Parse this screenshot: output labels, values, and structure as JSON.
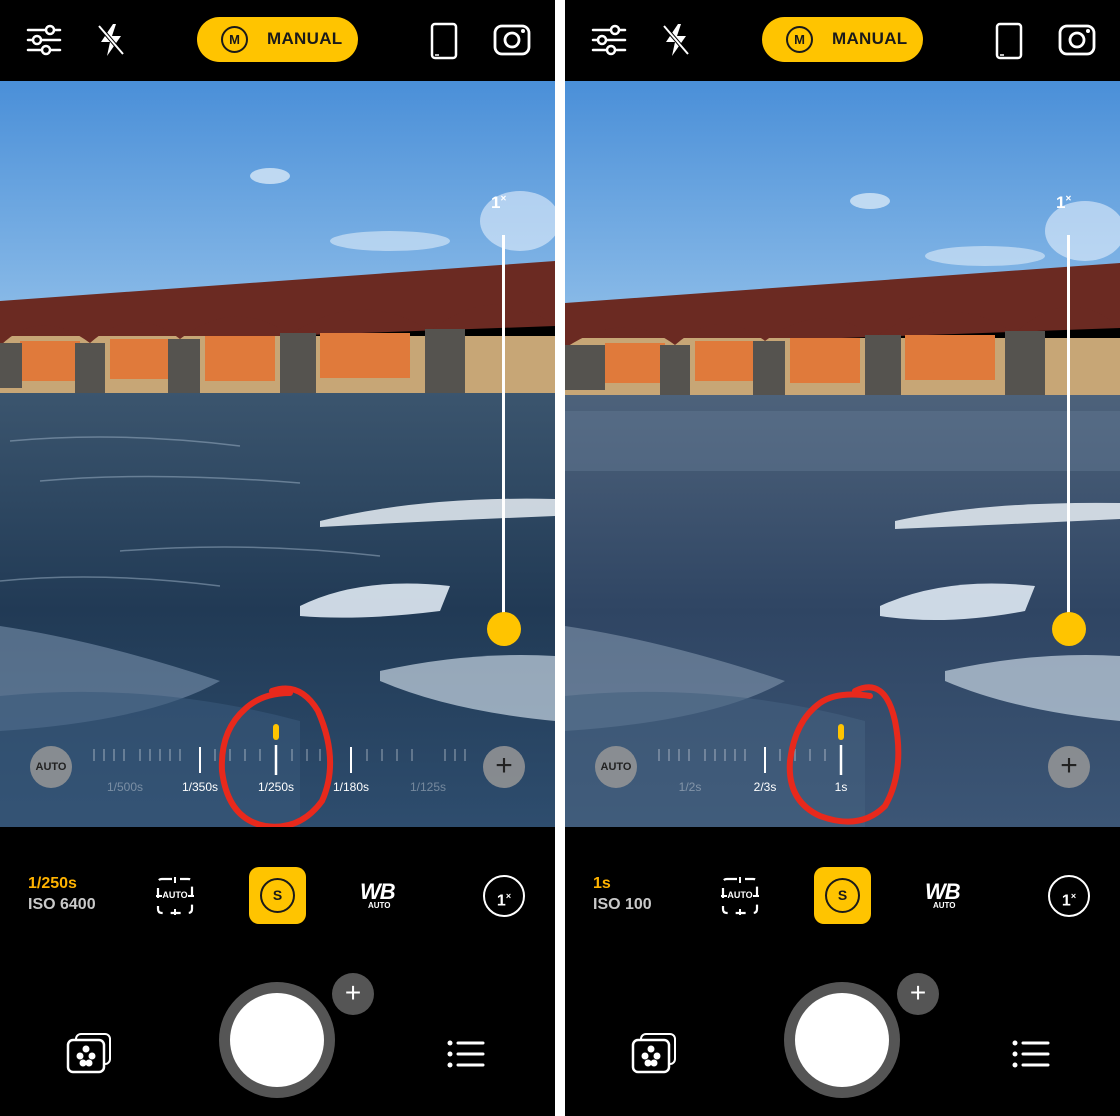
{
  "panels": [
    {
      "mode_label": "MANUAL",
      "mode_letter": "M",
      "zoom_slider_label": "1",
      "zoom_slider_unit": "×",
      "auto_label": "AUTO",
      "plus_label": "+",
      "shutter_ticks": [
        {
          "label": "1/500s",
          "dim": true
        },
        {
          "label": "1/350s",
          "dim": false
        },
        {
          "label": "1/250s",
          "dim": false,
          "selected": true
        },
        {
          "label": "1/180s",
          "dim": false
        },
        {
          "label": "1/125s",
          "dim": true
        }
      ],
      "shutter_speed": "1/250s",
      "iso": "ISO 6400",
      "focus_auto_label": "AUTO",
      "s_button_letter": "S",
      "wb_label": "WB",
      "wb_sub_label": "AUTO",
      "zoom_button_label": "1",
      "zoom_button_unit": "×",
      "shutter_plus": "+",
      "scene": "high-speed"
    },
    {
      "mode_label": "MANUAL",
      "mode_letter": "M",
      "zoom_slider_label": "1",
      "zoom_slider_unit": "×",
      "auto_label": "AUTO",
      "plus_label": "+",
      "shutter_ticks": [
        {
          "label": "1/2s",
          "dim": true
        },
        {
          "label": "2/3s",
          "dim": false
        },
        {
          "label": "1s",
          "dim": false,
          "selected": true
        }
      ],
      "shutter_speed": "1s",
      "iso": "ISO 100",
      "focus_auto_label": "AUTO",
      "s_button_letter": "S",
      "wb_label": "WB",
      "wb_sub_label": "AUTO",
      "zoom_button_label": "1",
      "zoom_button_unit": "×",
      "shutter_plus": "+",
      "scene": "long-exposure"
    }
  ],
  "colors": {
    "accent_yellow": "#ffc400",
    "shutter_value": "#ffb300",
    "annotation_red": "#e8291c",
    "sky": "#5b9ee0",
    "bridge": "#6b2a22",
    "water": "#24415f"
  }
}
